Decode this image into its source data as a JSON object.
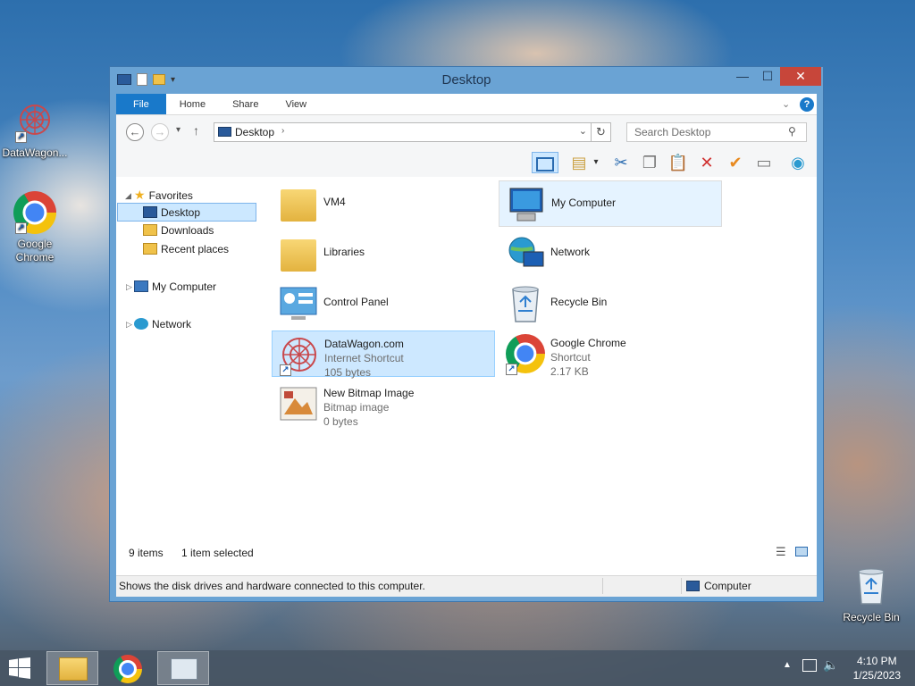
{
  "desktop": {
    "icons": [
      {
        "label": "DataWagon...",
        "icon": "datawagon-icon"
      },
      {
        "label": "Google Chrome",
        "icon": "chrome-icon"
      },
      {
        "label": "Recycle Bin",
        "icon": "recycle-bin-icon"
      }
    ]
  },
  "window": {
    "title": "Desktop",
    "controls": {
      "minimize": "—",
      "maximize": "☐",
      "close": "✕"
    }
  },
  "ribbon": {
    "tabs": [
      "File",
      "Home",
      "Share",
      "View"
    ]
  },
  "address": {
    "path": "Desktop",
    "search_placeholder": "Search Desktop"
  },
  "nav_pane": {
    "favorites_label": "Favorites",
    "favorites": [
      "Desktop",
      "Downloads",
      "Recent places"
    ],
    "my_computer": "My Computer",
    "network": "Network",
    "selected": "Desktop"
  },
  "items": [
    {
      "name": "VM4",
      "icon": "user-folder-icon"
    },
    {
      "name": "My Computer",
      "icon": "computer-icon"
    },
    {
      "name": "Libraries",
      "icon": "libraries-icon"
    },
    {
      "name": "Network",
      "icon": "network-icon"
    },
    {
      "name": "Control Panel",
      "icon": "control-panel-icon"
    },
    {
      "name": "Recycle Bin",
      "icon": "recycle-bin-icon"
    },
    {
      "name": "DataWagon.com",
      "type": "Internet Shortcut",
      "size": "105 bytes",
      "icon": "datawagon-icon"
    },
    {
      "name": "Google Chrome",
      "type": "Shortcut",
      "size": "2.17 KB",
      "icon": "chrome-icon"
    },
    {
      "name": "New Bitmap Image",
      "type": "Bitmap image",
      "size": "0 bytes",
      "icon": "bitmap-icon"
    }
  ],
  "status": {
    "count": "9 items",
    "selection": "1 item selected",
    "description": "Shows the disk drives and hardware connected to this computer.",
    "location": "Computer"
  },
  "taskbar": {
    "time": "4:10 PM",
    "date": "1/25/2023"
  },
  "colors": {
    "accent": "#1979ca",
    "selection": "#cde8ff",
    "close": "#c7463a"
  }
}
